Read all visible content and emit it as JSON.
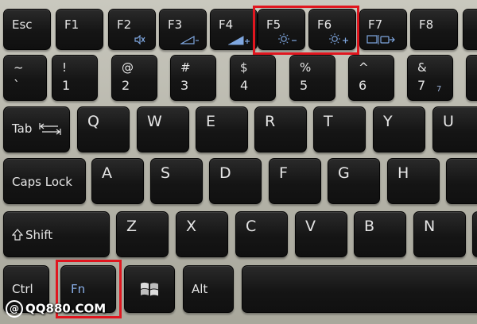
{
  "function_row": {
    "esc": "Esc",
    "f1": "F1",
    "f2": "F2",
    "f3": "F3",
    "f4": "F4",
    "f5": "F5",
    "f6": "F6",
    "f7": "F7",
    "f8": "F8"
  },
  "number_row": {
    "tilde": {
      "top": "~",
      "bottom": "`"
    },
    "k1": {
      "top": "!",
      "bottom": "1"
    },
    "k2": {
      "top": "@",
      "bottom": "2"
    },
    "k3": {
      "top": "#",
      "bottom": "3"
    },
    "k4": {
      "top": "$",
      "bottom": "4"
    },
    "k5": {
      "top": "%",
      "bottom": "5"
    },
    "k6": {
      "top": "^",
      "bottom": "6"
    },
    "k7": {
      "top": "&",
      "bottom": "7",
      "side": "7"
    }
  },
  "qwerty_row": {
    "tab": "Tab",
    "q": "Q",
    "w": "W",
    "e": "E",
    "r": "R",
    "t": "T",
    "y": "Y",
    "u": "U"
  },
  "home_row": {
    "caps": "Caps Lock",
    "a": "A",
    "s": "S",
    "d": "D",
    "f": "F",
    "g": "G",
    "h": "H"
  },
  "bottom_letter_row": {
    "shift": "Shift",
    "z": "Z",
    "x": "X",
    "c": "C",
    "v": "V",
    "b": "B",
    "n": "N"
  },
  "modifier_row": {
    "ctrl": "Ctrl",
    "fn": "Fn",
    "alt": "Alt"
  },
  "watermark": {
    "at": "@",
    "text": "QQ880.COM"
  },
  "colors": {
    "highlight": "#e0161f",
    "fn_blue": "#8ab0ea",
    "key": "#1a1a1a",
    "frame": "#b9b8ae"
  },
  "icons": [
    "mute-icon",
    "volume-down-icon",
    "volume-up-icon",
    "brightness-down-icon",
    "brightness-up-icon",
    "display-switch-icon",
    "tab-arrows-icon",
    "shift-arrow-icon",
    "windows-logo-icon"
  ]
}
